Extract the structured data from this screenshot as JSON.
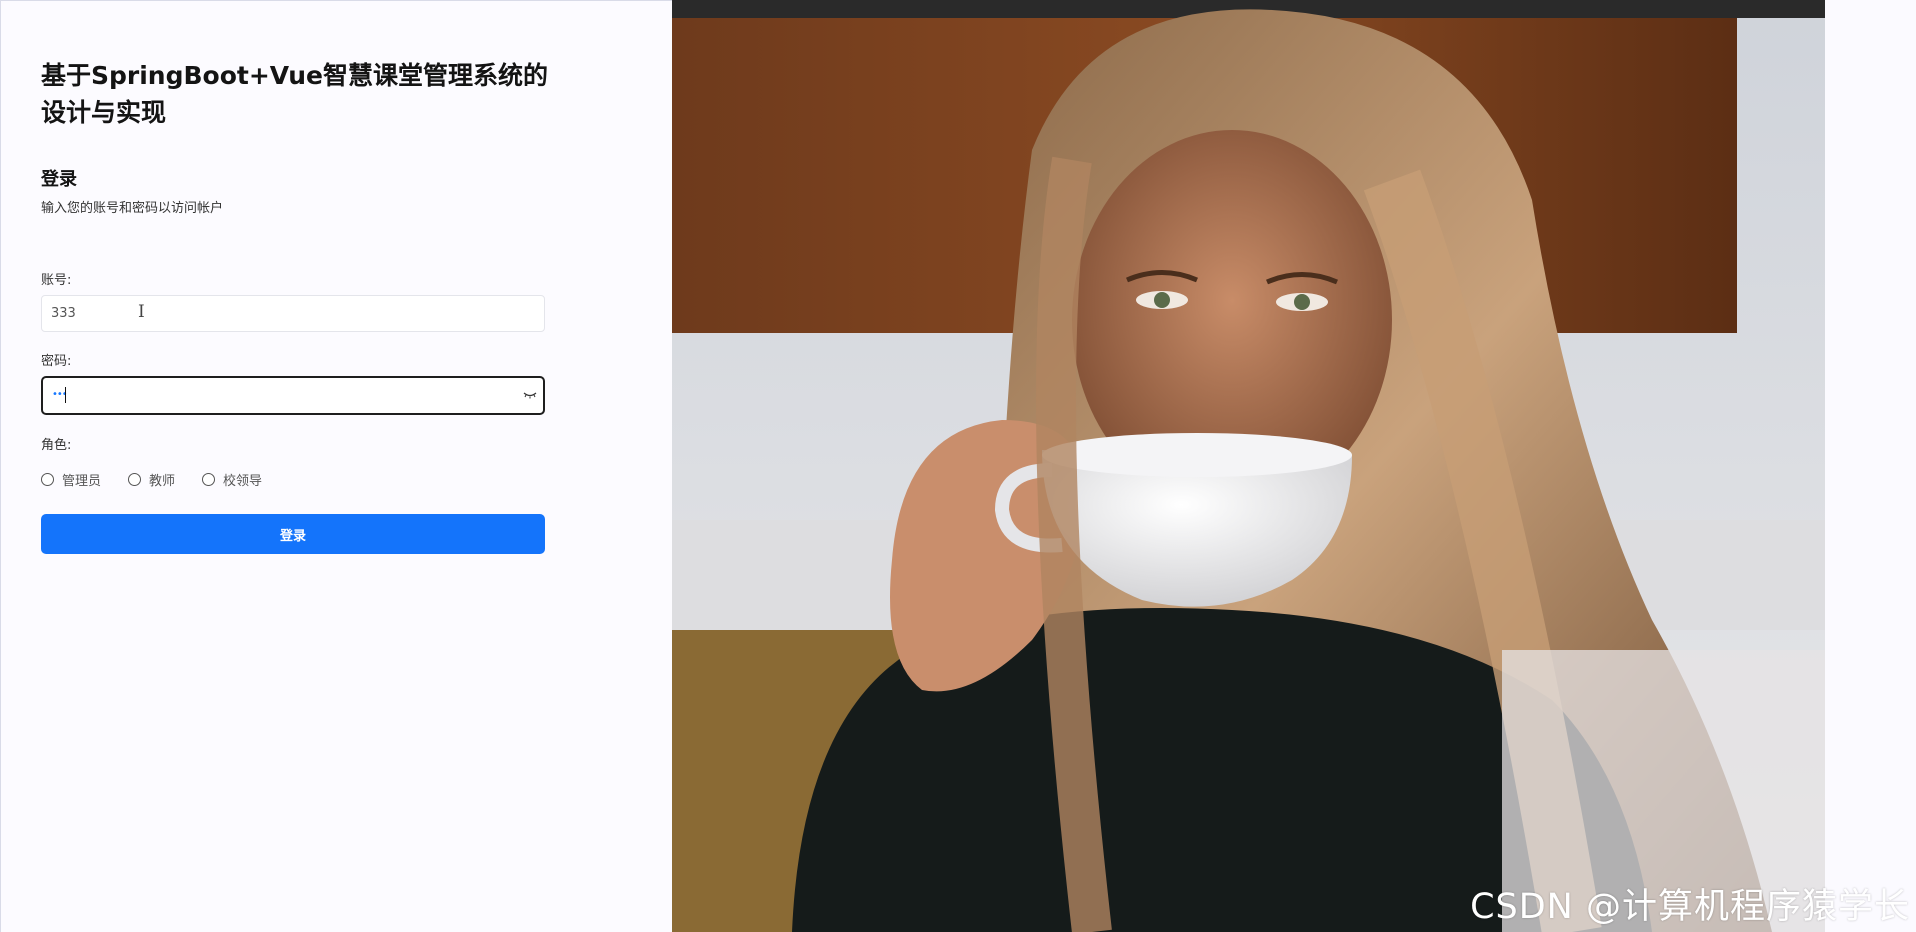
{
  "app": {
    "title": "基于SpringBoot+Vue智慧课堂管理系统的设计与实现"
  },
  "login": {
    "heading": "登录",
    "subtitle": "输入您的账号和密码以访问帐户",
    "account_label": "账号:",
    "account_value": "333",
    "password_label": "密码:",
    "password_masked": "•••",
    "role_label": "角色:",
    "roles": [
      {
        "label": "管理员",
        "checked": false
      },
      {
        "label": "教师",
        "checked": false
      },
      {
        "label": "校领导",
        "checked": false
      }
    ],
    "submit_label": "登录"
  },
  "icons": {
    "password_toggle": "eye-closed-icon"
  },
  "colors": {
    "primary": "#1474fb",
    "focus_border": "#1e1e1e"
  },
  "watermark": "CSDN @计算机程序猿学长"
}
